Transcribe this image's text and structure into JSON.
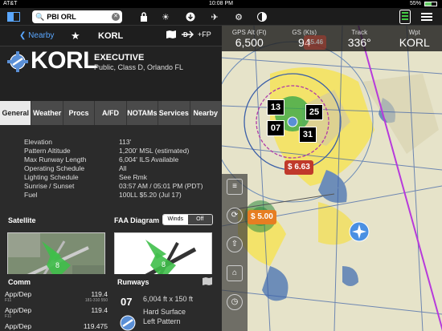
{
  "status": {
    "carrier": "AT&T",
    "time": "10:08 PM",
    "battery": "55%",
    "battery_level": 0.55
  },
  "search": {
    "value": "PBI ORL"
  },
  "nav": {
    "back_label": "Nearby",
    "airport_id": "KORL",
    "fp_label": "+FP"
  },
  "airport": {
    "id": "KORL",
    "name": "EXECUTIVE",
    "subtitle": "Public, Class D, Orlando FL"
  },
  "tabs": [
    "General",
    "Weather",
    "Procs",
    "A/FD",
    "NOTAMs",
    "Services",
    "Nearby"
  ],
  "active_tab": "General",
  "info": [
    {
      "k": "Elevation",
      "v": "113'"
    },
    {
      "k": "Pattern Altitude",
      "v": "1,200' MSL (estimated)"
    },
    {
      "k": "Max Runway Length",
      "v": "6,004' ILS Available"
    },
    {
      "k": "Operating Schedule",
      "v": "All"
    },
    {
      "k": "Lighting Schedule",
      "v": "See Rmk"
    },
    {
      "k": "Sunrise / Sunset",
      "v": "03:57 AM / 05:01 PM (PDT)"
    },
    {
      "k": "Fuel",
      "v": "100LL $5.20 (Jul 17)"
    }
  ],
  "satellite": {
    "label": "Satellite",
    "marker": "8"
  },
  "faa": {
    "label": "FAA Diagram",
    "winds_on": "Winds On",
    "off": "Off",
    "marker": "8"
  },
  "comm": {
    "label": "Comm",
    "items": [
      {
        "name": "App/Dep",
        "freq": "119.4",
        "sub": "F11",
        "sub2": "181-310 550"
      },
      {
        "name": "App/Dep",
        "freq": "119.4",
        "sub": "F11",
        "sub2": ""
      },
      {
        "name": "App/Dep",
        "freq": "119.475",
        "sub": "",
        "sub2": ""
      }
    ]
  },
  "runways": {
    "label": "Runways",
    "number": "07",
    "dims": "6,004 ft x 150 ft",
    "surface": "Hard Surface",
    "pattern": "Left Pattern"
  },
  "hud": [
    {
      "label": "GPS Alt (Ft)",
      "value": "6,500"
    },
    {
      "label": "GS (Kts)",
      "value": "94"
    },
    {
      "label": "Track",
      "value": "336°"
    },
    {
      "label": "Wpt",
      "value": "KORL"
    }
  ],
  "map_labels": {
    "b13": "13",
    "b25": "25",
    "b07": "07",
    "b31": "31",
    "price1": "$ 6.63",
    "price2": "$ 5.00",
    "price_top": "$5.46"
  },
  "colors": {
    "accent": "#5aa7ff",
    "price_red": "#c0392b",
    "price_orange": "#e67e22",
    "route": "#b73adb"
  }
}
